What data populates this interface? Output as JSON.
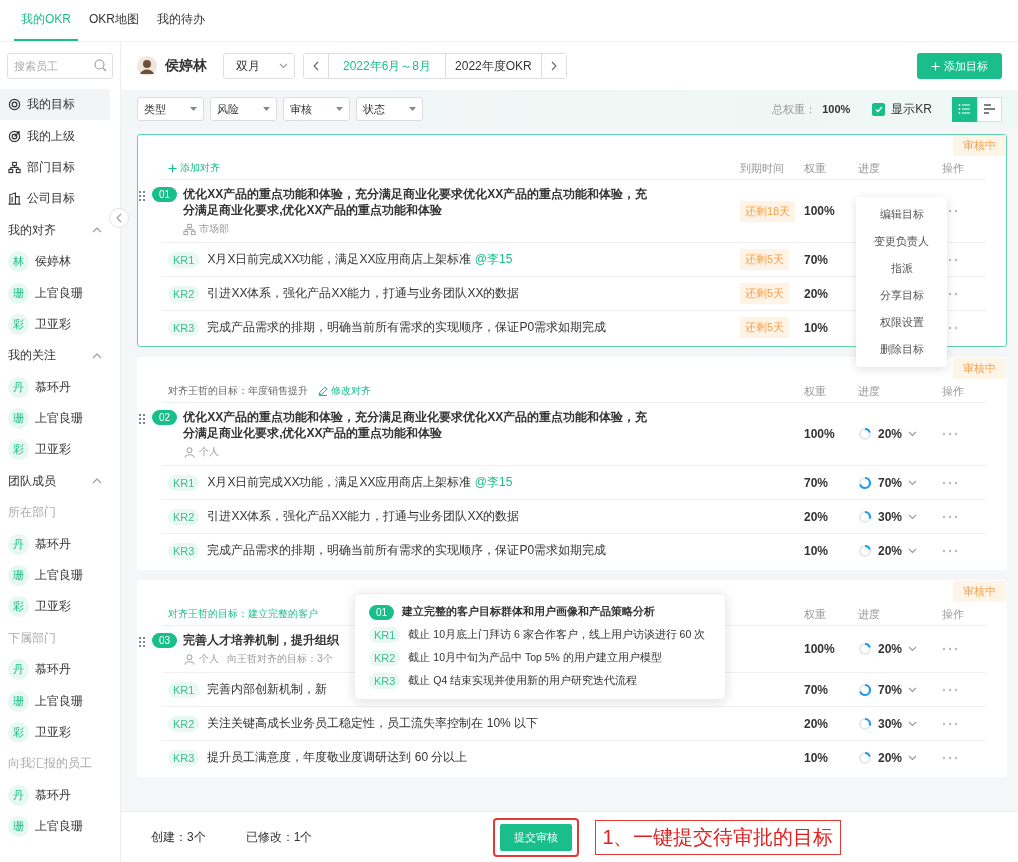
{
  "tabs": [
    {
      "label": "我的OKR",
      "selected": true
    },
    {
      "label": "OKR地图",
      "selected": false
    },
    {
      "label": "我的待办",
      "selected": false
    }
  ],
  "sidebar": {
    "search_placeholder": "搜索员工",
    "items": [
      {
        "kind": "nav",
        "label": "我的目标",
        "selected": true
      },
      {
        "kind": "nav",
        "label": "我的上级",
        "selected": false
      },
      {
        "kind": "nav",
        "label": "部门目标",
        "selected": false
      },
      {
        "kind": "nav",
        "label": "公司目标",
        "selected": false
      },
      {
        "kind": "section",
        "label": "我的对齐",
        "expanded": true
      },
      {
        "kind": "person",
        "avatar": "林",
        "label": "侯婷林",
        "selected": false
      },
      {
        "kind": "person",
        "avatar": "珊",
        "label": "上官良珊",
        "selected": false
      },
      {
        "kind": "person",
        "avatar": "彩",
        "label": "卫亚彩",
        "selected": false
      },
      {
        "kind": "section",
        "label": "我的关注",
        "expanded": true
      },
      {
        "kind": "person",
        "avatar": "丹",
        "label": "慕环丹",
        "selected": false
      },
      {
        "kind": "person",
        "avatar": "珊",
        "label": "上官良珊",
        "selected": false
      },
      {
        "kind": "person",
        "avatar": "彩",
        "label": "卫亚彩",
        "selected": false
      },
      {
        "kind": "section",
        "label": "团队成员",
        "expanded": true
      },
      {
        "kind": "group",
        "label": "所在部门"
      },
      {
        "kind": "person",
        "avatar": "丹",
        "label": "慕环丹",
        "selected": false
      },
      {
        "kind": "person",
        "avatar": "珊",
        "label": "上官良珊",
        "selected": false
      },
      {
        "kind": "person",
        "avatar": "彩",
        "label": "卫亚彩",
        "selected": false
      },
      {
        "kind": "group",
        "label": "下属部门"
      },
      {
        "kind": "person",
        "avatar": "丹",
        "label": "慕环丹",
        "selected": false
      },
      {
        "kind": "person",
        "avatar": "珊",
        "label": "上官良珊",
        "selected": false
      },
      {
        "kind": "person",
        "avatar": "彩",
        "label": "卫亚彩",
        "selected": false
      },
      {
        "kind": "group",
        "label": "向我汇报的员工"
      },
      {
        "kind": "person",
        "avatar": "丹",
        "label": "慕环丹",
        "selected": false
      },
      {
        "kind": "person",
        "avatar": "珊",
        "label": "上官良珊",
        "selected": false
      }
    ]
  },
  "header": {
    "user": {
      "name": "侯婷林"
    },
    "period": "双月",
    "date_range": "2022年6月～8月",
    "year_okr": "2022年度OKR",
    "add_button": "添加目标"
  },
  "filters": [
    {
      "label": "类型"
    },
    {
      "label": "风险"
    },
    {
      "label": "审核"
    },
    {
      "label": "状态"
    }
  ],
  "summary": {
    "total_weight_label": "总权重：",
    "total_weight": "100%",
    "show_kr": {
      "label": "显示KR",
      "checked": true
    },
    "views": [
      {
        "kind": "list",
        "selected": true
      },
      {
        "kind": "gantt",
        "selected": false
      }
    ]
  },
  "cards": [
    {
      "selected": true,
      "status": "审核中",
      "align": {
        "kind": "add",
        "text": "添加对齐"
      },
      "columns": [
        {
          "kind": "due",
          "label": "到期时间"
        },
        {
          "kind": "weight",
          "label": "权重"
        },
        {
          "kind": "progress",
          "label": "进度"
        },
        {
          "kind": "ops",
          "label": "操作"
        }
      ],
      "objective": {
        "number": "01",
        "title": "优化XX产品的重点功能和体验，充分满足商业化要求优化XX产品的重点功能和体验，充分满足商业化要求,优化XX产品的重点功能和体验",
        "meta": [
          {
            "kind": "department",
            "text": "市场部"
          }
        ],
        "due": "还剩18天",
        "weight": "100%"
      },
      "krs": [
        {
          "label": "KR1",
          "text": "X月X日前完成XX功能，满足XX应用商店上架标准",
          "mention": "@李15",
          "due": "还剩5天",
          "weight": "70%"
        },
        {
          "label": "KR2",
          "text": "引进XX体系，强化产品XX能力，打通与业务团队XX的数据",
          "due": "还剩5天",
          "weight": "20%"
        },
        {
          "label": "KR3",
          "text": "完成产品需求的排期，明确当前所有需求的实现顺序，保证P0需求如期完成",
          "due": "还剩5天",
          "weight": "10%"
        }
      ],
      "action_menu": [
        "编辑目标",
        "变更负责人",
        "指派",
        "分享目标",
        "权限设置",
        "删除目标"
      ]
    },
    {
      "selected": false,
      "status": "审核中",
      "align": {
        "kind": "aligned",
        "text": "对齐王哲的目标：年度销售提升",
        "link": "修改对齐"
      },
      "columns": [
        {
          "kind": "weight",
          "label": "权重"
        },
        {
          "kind": "progress",
          "label": "进度"
        },
        {
          "kind": "ops",
          "label": "操作"
        }
      ],
      "objective": {
        "number": "02",
        "title": "优化XX产品的重点功能和体验，充分满足商业化要求优化XX产品的重点功能和体验，充分满足商业化要求,优化XX产品的重点功能和体验",
        "meta": [
          {
            "kind": "person",
            "text": "个人"
          }
        ],
        "weight": "100%",
        "progress": {
          "level": 0.2,
          "text": "20%"
        }
      },
      "krs": [
        {
          "label": "KR1",
          "text": "X月X日前完成XX功能，满足XX应用商店上架标准",
          "mention": "@李15",
          "weight": "70%",
          "progress": {
            "level": 0.7,
            "text": "70%"
          }
        },
        {
          "label": "KR2",
          "text": "引进XX体系，强化产品XX能力，打通与业务团队XX的数据",
          "weight": "20%",
          "progress": {
            "level": 0.3,
            "text": "30%"
          }
        },
        {
          "label": "KR3",
          "text": "完成产品需求的排期，明确当前所有需求的实现顺序，保证P0需求如期完成",
          "weight": "10%",
          "progress": {
            "level": 0.2,
            "text": "20%"
          }
        }
      ]
    },
    {
      "selected": false,
      "status": "审核中",
      "align": {
        "kind": "highlight",
        "text": "对齐王哲的目标：建立完整的客户"
      },
      "columns": [
        {
          "kind": "weight",
          "label": "权重"
        },
        {
          "kind": "progress",
          "label": "进度"
        },
        {
          "kind": "ops",
          "label": "操作"
        }
      ],
      "objective": {
        "number": "03",
        "title": "完善人才培养机制，提升组织",
        "meta": [
          {
            "kind": "person",
            "text": "个人"
          },
          {
            "kind": "plain",
            "text": "向王哲对齐的目标：3个"
          }
        ],
        "weight": "100%",
        "progress": {
          "level": 0.2,
          "text": "20%"
        }
      },
      "krs": [
        {
          "label": "KR1",
          "text": "完善内部创新机制，新",
          "weight": "70%",
          "progress": {
            "level": 0.7,
            "text": "70%"
          }
        },
        {
          "label": "KR2",
          "text": "关注关键高成长业务员工稳定性，员工流失率控制在 10% 以下",
          "weight": "20%",
          "progress": {
            "level": 0.3,
            "text": "30%"
          }
        },
        {
          "label": "KR3",
          "text": "提升员工满意度，年度敬业度调研达到 60 分以上",
          "weight": "10%",
          "progress": {
            "level": 0.2,
            "text": "20%"
          }
        }
      ],
      "align_popover": {
        "number": "01",
        "title": "建立完整的客户目标群体和用户画像和产品策略分析",
        "krs": [
          {
            "label": "KR1",
            "text": "截止 10月底上门拜访 6 家合作客户，线上用户访谈进行 60 次"
          },
          {
            "label": "KR2",
            "text": "截止 10月中旬为产品中 Top 5% 的用户建立用户模型"
          },
          {
            "label": "KR3",
            "text": "截止 Q4 结束实现并使用新的用户研究迭代流程"
          }
        ]
      }
    }
  ],
  "footer": {
    "created": "创建：3个",
    "modified": "已修改：1个",
    "submit": "提交审核",
    "annotation": "1、一键提交待审批的目标"
  }
}
